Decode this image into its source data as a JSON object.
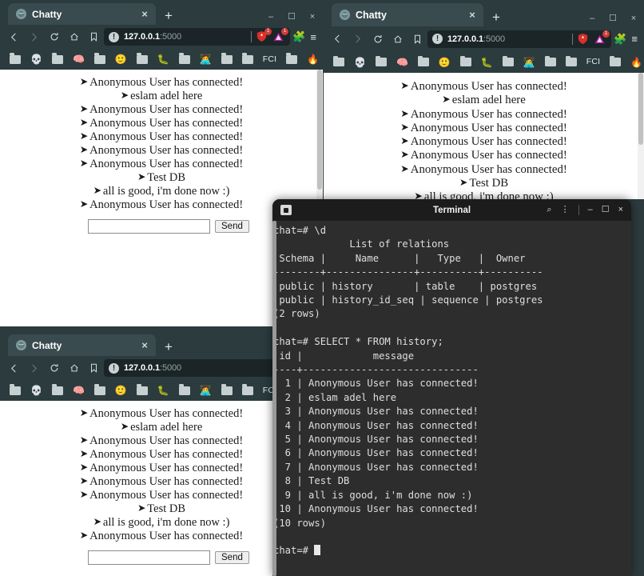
{
  "browser": {
    "tab_title": "Chatty",
    "tab_close": "×",
    "new_tab": "+",
    "minimize": "–",
    "maximize": "☐",
    "close": "×",
    "url": "127.0.0.1",
    "url_port": ":5000",
    "url_info_icon": "!",
    "shield_badge": "1",
    "warn_badge": "1",
    "bookmarks_more": "»",
    "bookmarks": [
      {
        "type": "folder",
        "label": ""
      },
      {
        "type": "emoji",
        "label": "💀"
      },
      {
        "type": "folder",
        "label": ""
      },
      {
        "type": "emoji",
        "label": "🧠"
      },
      {
        "type": "folder",
        "label": ""
      },
      {
        "type": "emoji",
        "label": "🙂"
      },
      {
        "type": "folder",
        "label": ""
      },
      {
        "type": "emoji",
        "label": "🐛"
      },
      {
        "type": "folder",
        "label": ""
      },
      {
        "type": "emoji",
        "label": "👩‍💻"
      },
      {
        "type": "folder",
        "label": ""
      },
      {
        "type": "folder",
        "label": ""
      },
      {
        "type": "text",
        "label": "FCI"
      },
      {
        "type": "folder",
        "label": ""
      },
      {
        "type": "emoji",
        "label": "🔥"
      }
    ]
  },
  "chat": {
    "bullet": "➤",
    "messages": [
      "Anonymous User has connected!",
      "eslam adel here",
      "Anonymous User has connected!",
      "Anonymous User has connected!",
      "Anonymous User has connected!",
      "Anonymous User has connected!",
      "Anonymous User has connected!",
      "Test DB",
      "all is good, i'm done now :)",
      "Anonymous User has connected!"
    ],
    "input_value": "",
    "input_placeholder": "",
    "send_label": "Send"
  },
  "terminal": {
    "title": "Terminal",
    "search_icon": "⌕",
    "menu_icon": "⋮",
    "minimize": "–",
    "maximize": "☐",
    "close": "×",
    "lines": [
      "chat=# \\d",
      "             List of relations",
      " Schema |     Name      |   Type   |  Owner",
      "--------+---------------+----------+----------",
      " public | history       | table    | postgres",
      " public | history_id_seq | sequence | postgres",
      "(2 rows)",
      "",
      "chat=# SELECT * FROM history;",
      " id |            message",
      "----+------------------------------",
      "  1 | Anonymous User has connected!",
      "  2 | eslam adel here",
      "  3 | Anonymous User has connected!",
      "  4 | Anonymous User has connected!",
      "  5 | Anonymous User has connected!",
      "  6 | Anonymous User has connected!",
      "  7 | Anonymous User has connected!",
      "  8 | Test DB",
      "  9 | all is good, i'm done now :)",
      " 10 | Anonymous User has connected!",
      "(10 rows)",
      "",
      "chat=# "
    ],
    "prompt": "chat=# "
  }
}
